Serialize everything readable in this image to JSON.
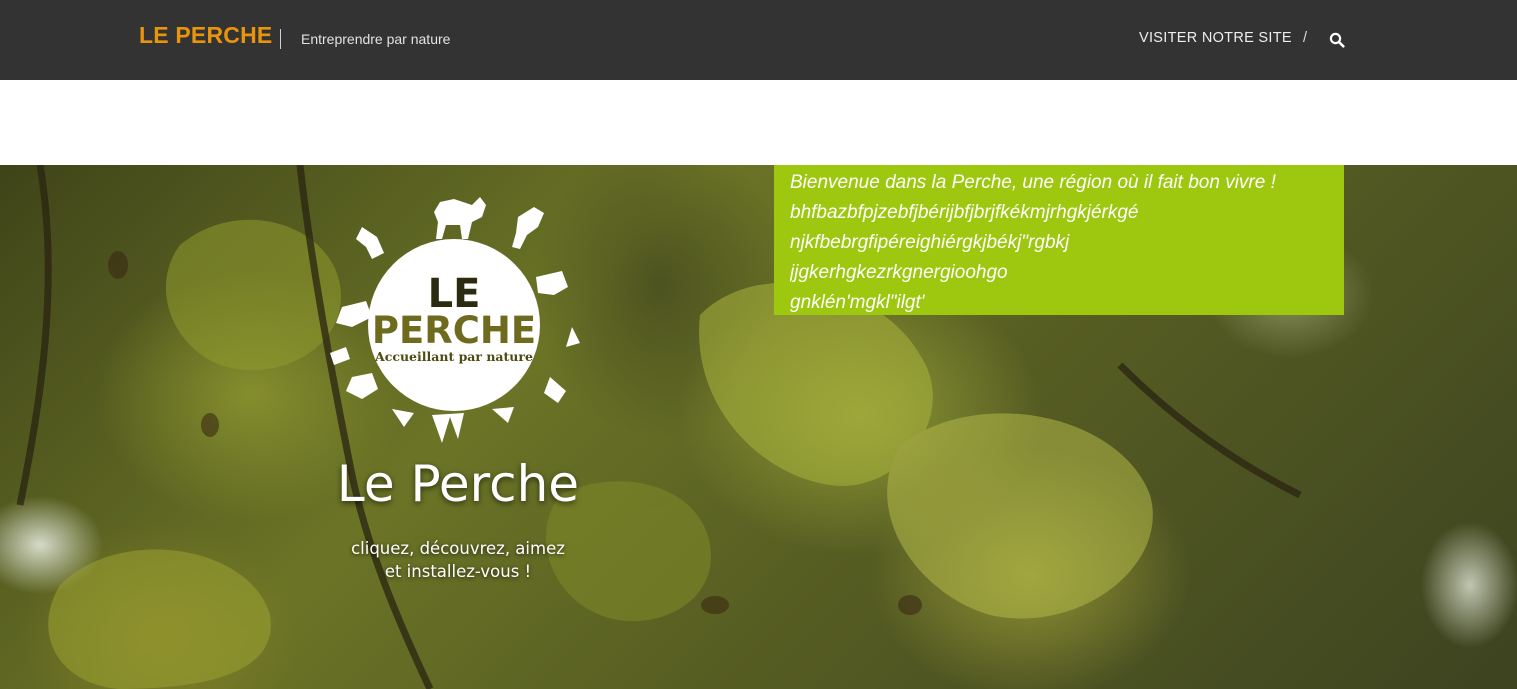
{
  "header": {
    "brand": "LE PERCHE",
    "tagline": "Entreprendre par nature",
    "nav_link": "VISITER NOTRE SITE",
    "separator": "/",
    "search_icon": "search-icon"
  },
  "hero": {
    "logo": {
      "line1": "LE",
      "line2": "PERCHE",
      "line3": "Accueillant par nature"
    },
    "title": "Le Perche",
    "subtitle_line1": "cliquez, découvrez, aimez",
    "subtitle_line2": "et installez-vous !",
    "welcome_lines": [
      "Bienvenue dans la Perche, une région où il fait bon vivre !",
      "bhfbazbfpjzebfjbérijbfjbrjfkékmjrhgkjérkgé",
      "njkfbebrgfipéreighiérgkjbékj\"rgbkj",
      "jjgkerhgkezrkgnergioohgo",
      "gnklén'mgkl\"ilgt'"
    ]
  },
  "colors": {
    "topbar": "#333333",
    "brand": "#e8940c",
    "welcome_box": "#9ec80f"
  }
}
